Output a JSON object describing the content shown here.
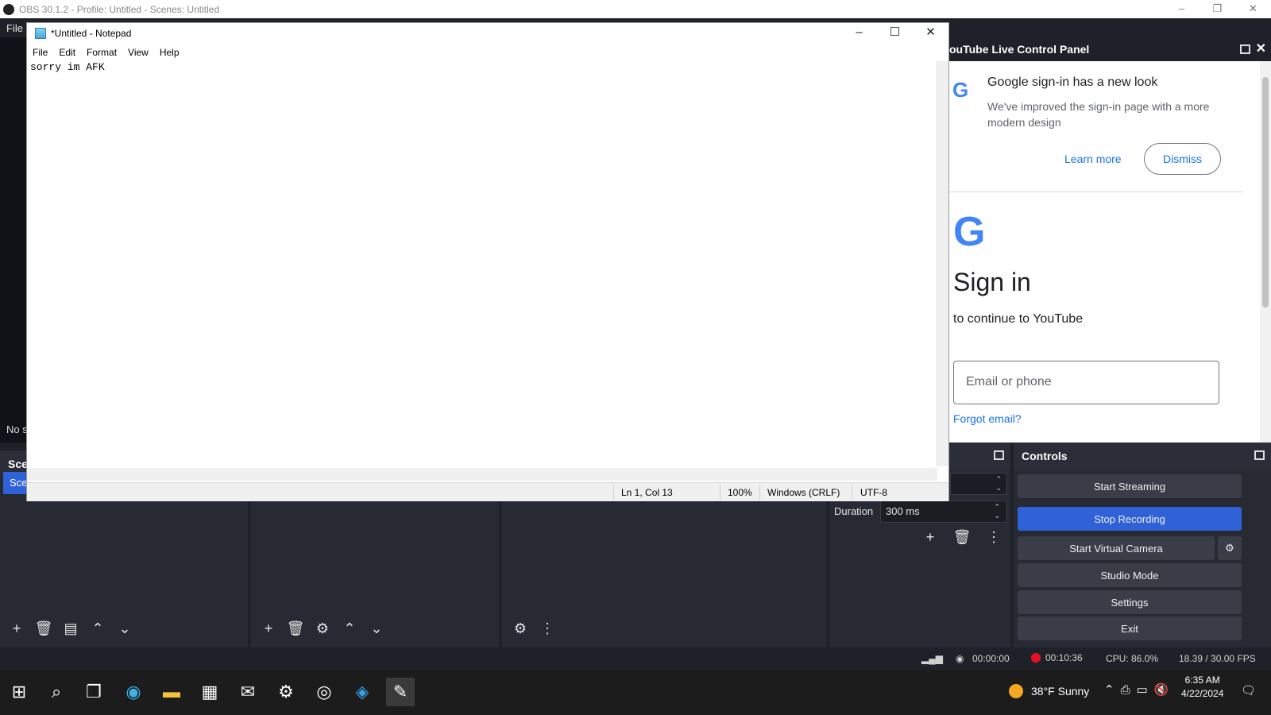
{
  "obs": {
    "title": "OBS 30.1.2 - Profile: Untitled - Scenes: Untitled",
    "menu_file": "File",
    "no_source": "No s",
    "window_buttons": [
      "–",
      "❐",
      "✕"
    ]
  },
  "scenes": {
    "header": "Sce",
    "item": "Sce"
  },
  "transitions": {
    "duration_label": "Duration",
    "duration_value": "300 ms"
  },
  "controls": {
    "header": "Controls",
    "start_streaming": "Start Streaming",
    "stop_recording": "Stop Recording",
    "start_virtual_camera": "Start Virtual Camera",
    "studio_mode": "Studio Mode",
    "settings": "Settings",
    "exit": "Exit"
  },
  "status": {
    "stream_time": "00:00:00",
    "record_time": "00:10:36",
    "cpu": "CPU: 86.0%",
    "fps": "18.39 / 30.00 FPS"
  },
  "youtube": {
    "header": "ouTube Live Control Panel",
    "notice_title": "Google sign-in has a new look",
    "notice_body": "We've improved the sign-in page with a more modern design",
    "learn_more": "Learn more",
    "dismiss": "Dismiss",
    "sign_in": "Sign in",
    "continue": "to continue to YouTube",
    "email_placeholder": "Email or phone",
    "forgot_email": "Forgot email?"
  },
  "notepad": {
    "title": "*Untitled - Notepad",
    "menu": [
      "File",
      "Edit",
      "Format",
      "View",
      "Help"
    ],
    "content": "sorry im AFK",
    "status_position": "Ln 1, Col 13",
    "status_zoom": "100%",
    "status_line_endings": "Windows (CRLF)",
    "status_encoding": "UTF-8"
  },
  "taskbar": {
    "weather": "38°F  Sunny",
    "time": "6:35 AM",
    "date": "4/22/2024"
  },
  "colors": {
    "accent": "#2f61d8",
    "record": "#e81123",
    "google_blue": "#1a73e8"
  }
}
